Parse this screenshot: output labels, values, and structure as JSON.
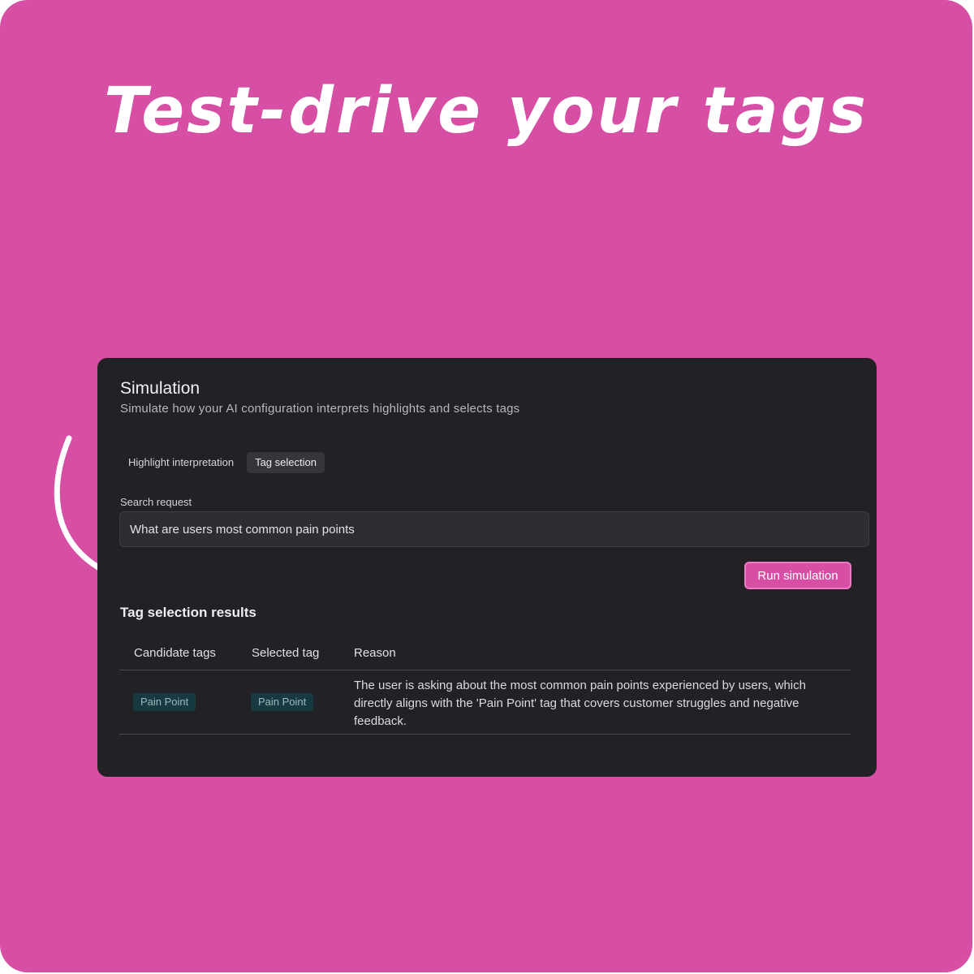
{
  "headline": "Test-drive your tags",
  "simulation": {
    "title": "Simulation",
    "subtitle": "Simulate how your AI configuration interprets highlights and selects tags",
    "tabs": [
      {
        "label": "Highlight interpretation",
        "active": false
      },
      {
        "label": "Tag selection",
        "active": true
      }
    ],
    "search": {
      "label": "Search request",
      "value": "What are users most common pain points"
    },
    "run_button": "Run simulation",
    "results": {
      "title": "Tag selection results",
      "columns": [
        "Candidate tags",
        "Selected tag",
        "Reason"
      ],
      "rows": [
        {
          "candidate_tag": "Pain Point",
          "selected_tag": "Pain Point",
          "reason": "The user is asking about the most common pain points experienced by users, which directly aligns with the 'Pain Point' tag that covers customer struggles and negative feedback."
        }
      ]
    }
  },
  "colors": {
    "background": "#d64fa5",
    "card": "#222125",
    "accent": "#d64fa5",
    "tag_chip": "#173a40"
  }
}
